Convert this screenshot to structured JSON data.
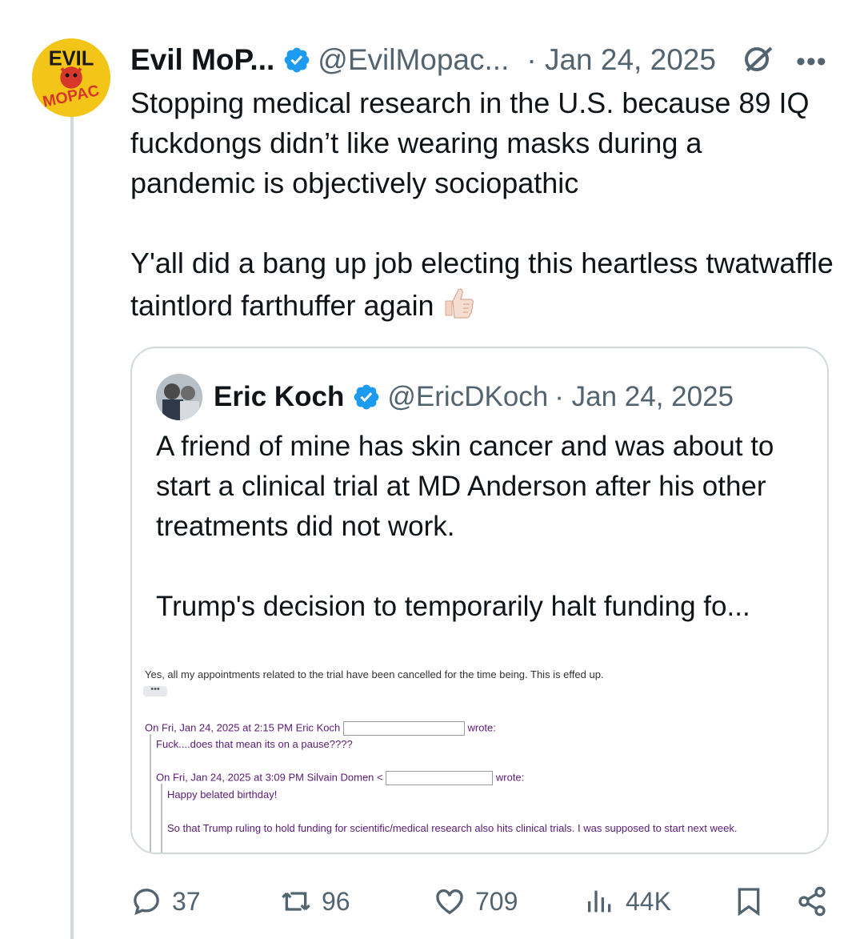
{
  "tweet": {
    "author_name": "Evil MoP...",
    "author_handle": "@EvilMopac...",
    "date": "· Jan 24, 2025",
    "more": "•••",
    "paragraphs": [
      "Stopping medical research in the U.S. because 89 IQ fuckdongs didn’t like wearing masks during a pandemic is objectively sociopathic",
      "Y'all did a bang up job electing this heartless twatwaffle taintlord farthuffer again"
    ],
    "emoji": "thumbs-up-light-skin"
  },
  "quote": {
    "author_name": "Eric Koch",
    "author_handle": "@EricDKoch",
    "date": "· Jan 24, 2025",
    "paragraphs": [
      "A friend of mine has skin cancer and was about to start a clinical trial at MD Anderson after his other treatments did not work.",
      "Trump's decision to temporarily halt funding fo..."
    ],
    "email": {
      "line1": "Yes, all my appointments related to the trial have been cancelled for the time being. This is effed up.",
      "dots": "•••",
      "reply1_header": "On Fri, Jan 24, 2025 at 2:15 PM Eric Koch",
      "reply1_wrote": "wrote:",
      "reply1_body": "Fuck....does that mean its on a pause????",
      "reply2_header": "On Fri, Jan 24, 2025 at 3:09 PM Silvain Domen <",
      "reply2_wrote": "wrote:",
      "reply2_body1": "Happy belated birthday!",
      "reply2_body2": "So that Trump ruling to hold funding for scientific/medical research also hits clinical trials. I was supposed to start next week."
    }
  },
  "actions": {
    "replies": "37",
    "reposts": "96",
    "likes": "709",
    "views": "44K"
  },
  "avatar_text": {
    "top": "EVIL",
    "bottom": "MOPAC"
  },
  "colors": {
    "verified": "#1d9bf0",
    "muted": "#536471",
    "text": "#0f1419",
    "border": "#cfd9de"
  }
}
